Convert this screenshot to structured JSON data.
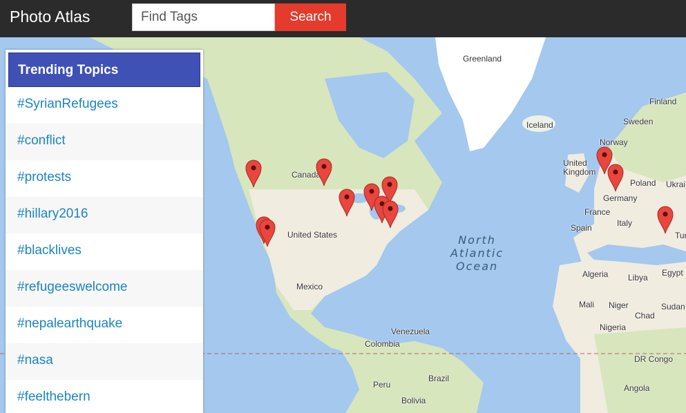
{
  "header": {
    "brand": "Photo Atlas",
    "search_placeholder": "Find Tags",
    "search_button": "Search"
  },
  "sidebar": {
    "title": "Trending Topics",
    "topics": [
      "#SyrianRefugees",
      "#conflict",
      "#protests",
      "#hillary2016",
      "#blacklives",
      "#refugeeswelcome",
      "#nepalearthquake",
      "#nasa",
      "#feelthebern"
    ]
  },
  "map": {
    "labels": {
      "greenland": "Greenland",
      "iceland": "Iceland",
      "finland": "Finland",
      "sweden": "Sweden",
      "norway": "Norway",
      "uk": "United\nKingdom",
      "poland": "Poland",
      "ukraine": "Ukrai",
      "germany": "Germany",
      "france": "France",
      "spain": "Spain",
      "italy": "Italy",
      "turkey": "Tur",
      "canada": "Canada",
      "usa": "United States",
      "mexico": "Mexico",
      "venezuela": "Venezuela",
      "colombia": "Colombia",
      "peru": "Peru",
      "brazil": "Brazil",
      "bolivia": "Bolivia",
      "algeria": "Algeria",
      "libya": "Libya",
      "egypt": "Egypt",
      "mali": "Mali",
      "niger": "Niger",
      "chad": "Chad",
      "sudan": "Sudan",
      "nigeria": "Nigeria",
      "drcongo": "DR Congo",
      "angola": "Angola",
      "ocean": "North\nAtlantic\nOcean"
    },
    "colors": {
      "land": "#f0ecdf",
      "forest": "#cfe3b0",
      "water": "#a4c8ee",
      "ice": "#ffffff",
      "pin": "#e8463e"
    }
  }
}
